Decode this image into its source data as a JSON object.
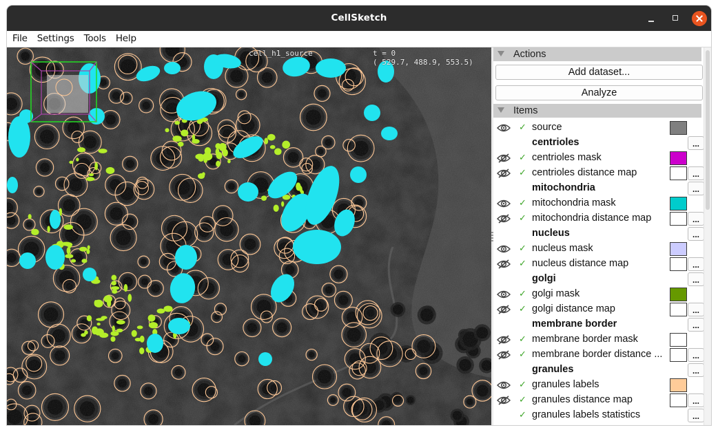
{
  "window": {
    "title": "CellSketch",
    "controls": {
      "minimize": "minimize",
      "maximize": "maximize",
      "close": "close"
    }
  },
  "menu": [
    "File",
    "Settings",
    "Tools",
    "Help"
  ],
  "viewer": {
    "layer_name": "cell_h1_source",
    "time_label": "t = 0",
    "coordinates": "( 529.7, 488.9, 553.5)",
    "colors": {
      "background": "#3b3b3b",
      "mitochondria": "#21e3ef",
      "golgi": "#b4ee2a",
      "granules_outline": "#ffc896",
      "bbox_outer": "#22dd22",
      "bbox_inner": "#aa44aa"
    }
  },
  "panel": {
    "actions": {
      "header": "Actions",
      "buttons": [
        "Add dataset...",
        "Analyze"
      ]
    },
    "items": {
      "header": "Items",
      "rows": [
        {
          "type": "layer",
          "label": "source",
          "visible": true,
          "checked": true,
          "color": "#808080",
          "more": false
        },
        {
          "type": "group",
          "label": "centrioles",
          "more": true
        },
        {
          "type": "layer",
          "label": "centrioles mask",
          "visible": false,
          "checked": true,
          "color": "#cc00cc",
          "more": false
        },
        {
          "type": "layer",
          "label": "centrioles distance map",
          "visible": false,
          "checked": true,
          "color": "#ffffff",
          "more": true
        },
        {
          "type": "group",
          "label": "mitochondria",
          "more": true
        },
        {
          "type": "layer",
          "label": "mitochondria mask",
          "visible": true,
          "checked": true,
          "color": "#00cccc",
          "more": false
        },
        {
          "type": "layer",
          "label": "mitochondria distance map",
          "visible": false,
          "checked": true,
          "color": "#ffffff",
          "more": true
        },
        {
          "type": "group",
          "label": "nucleus",
          "more": true
        },
        {
          "type": "layer",
          "label": "nucleus mask",
          "visible": true,
          "checked": true,
          "color": "#ccccff",
          "more": false
        },
        {
          "type": "layer",
          "label": "nucleus distance map",
          "visible": false,
          "checked": true,
          "color": "#ffffff",
          "more": true
        },
        {
          "type": "group",
          "label": "golgi",
          "more": true
        },
        {
          "type": "layer",
          "label": "golgi mask",
          "visible": true,
          "checked": true,
          "color": "#669900",
          "more": false
        },
        {
          "type": "layer",
          "label": "golgi distance map",
          "visible": false,
          "checked": true,
          "color": "#ffffff",
          "more": true
        },
        {
          "type": "group",
          "label": "membrane border",
          "more": true
        },
        {
          "type": "layer",
          "label": "membrane border mask",
          "visible": false,
          "checked": true,
          "color": "#ffffff",
          "more": false
        },
        {
          "type": "layer",
          "label": "membrane border distance ...",
          "visible": false,
          "checked": true,
          "color": "#ffffff",
          "more": true
        },
        {
          "type": "group",
          "label": "granules",
          "more": true
        },
        {
          "type": "layer",
          "label": "granules labels",
          "visible": true,
          "checked": true,
          "color": "#ffcc99",
          "more": false
        },
        {
          "type": "layer",
          "label": "granules distance map",
          "visible": false,
          "checked": true,
          "color": "#ffffff",
          "more": true
        },
        {
          "type": "stat",
          "label": "granules labels statistics",
          "checked": true,
          "more": true
        }
      ],
      "more_label": "...",
      "check_glyph": "✓"
    }
  }
}
